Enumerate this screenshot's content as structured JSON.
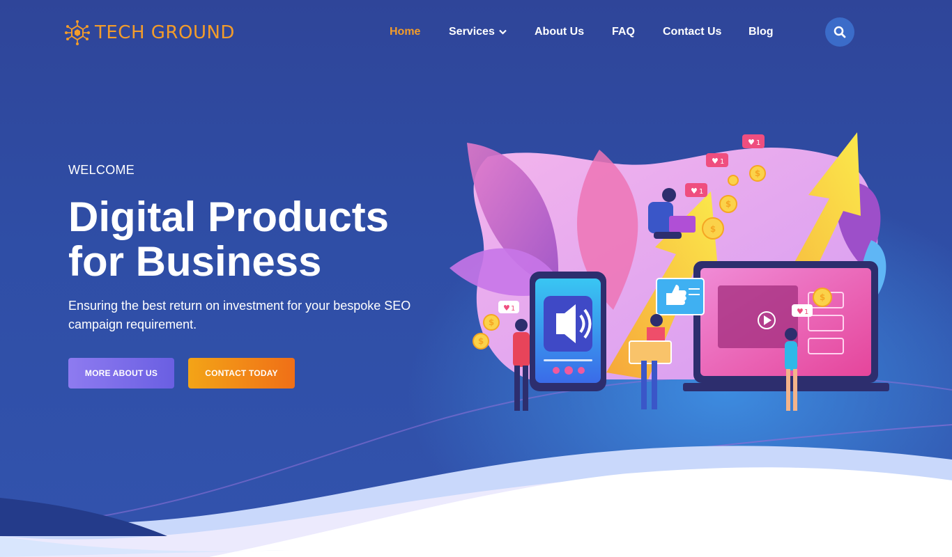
{
  "brand": {
    "name": "TECH GROUND",
    "color": "#f39c2a"
  },
  "nav": {
    "items": [
      {
        "label": "Home",
        "active": true
      },
      {
        "label": "Services",
        "has_dropdown": true
      },
      {
        "label": "About Us"
      },
      {
        "label": "FAQ"
      },
      {
        "label": "Contact Us"
      },
      {
        "label": "Blog"
      }
    ],
    "search_icon": "search-icon"
  },
  "hero": {
    "eyebrow": "WELCOME",
    "headline_line1": "Digital Products",
    "headline_line2": "for Business",
    "subtext_line1": "Ensuring the best return on investment for your bespoke SEO",
    "subtext_line2": "campaign requirement.",
    "primary_button": "MORE ABOUT US",
    "secondary_button": "CONTACT TODAY"
  },
  "illustration": {
    "like_counts": [
      "1",
      "1",
      "1",
      "1",
      "1"
    ],
    "coin_symbol": "$"
  },
  "colors": {
    "background": "#2f4ea6",
    "accent_orange": "#f39c2a",
    "button_purple": "#7b6cec",
    "button_orange": "#f28a17"
  }
}
